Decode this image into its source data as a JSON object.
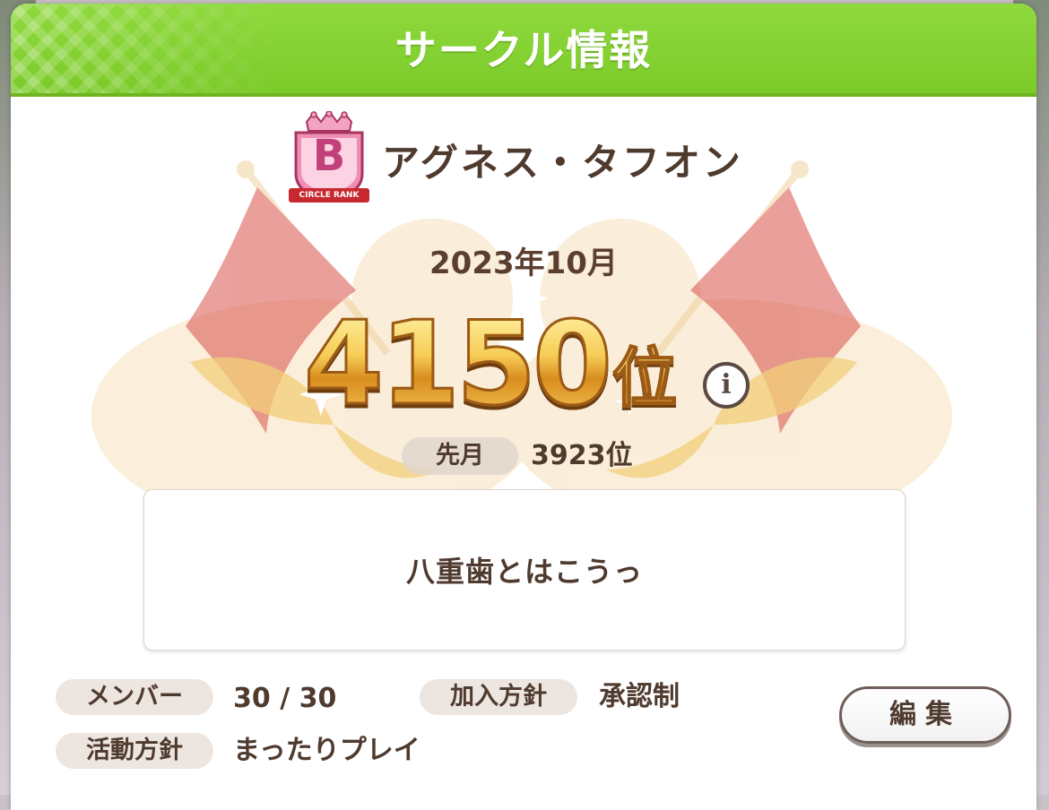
{
  "header": {
    "title": "サークル情報"
  },
  "circle": {
    "rank_badge_letter": "B",
    "rank_badge_caption": "CIRCLE RANK",
    "name": "アグネス・タフオン",
    "comment": "八重歯とはこうっ"
  },
  "ranking": {
    "month": "2023年10月",
    "current_rank": "4150",
    "rank_unit": "位",
    "info_label": "i",
    "last_month_label": "先月",
    "last_month_value": "3923位"
  },
  "details": {
    "members_label": "メンバー",
    "members_value": "30 / 30",
    "join_policy_label": "加入方針",
    "join_policy_value": "承認制",
    "activity_label": "活動方針",
    "activity_value": "まったりプレイ"
  },
  "actions": {
    "edit_label": "編集"
  },
  "colors": {
    "header_green": "#8fd93d",
    "text_brown": "#4f3a2e",
    "rank_gold": "#f6cd56",
    "flag_red": "#e7847c",
    "badge_pink": "#f08fb6"
  }
}
